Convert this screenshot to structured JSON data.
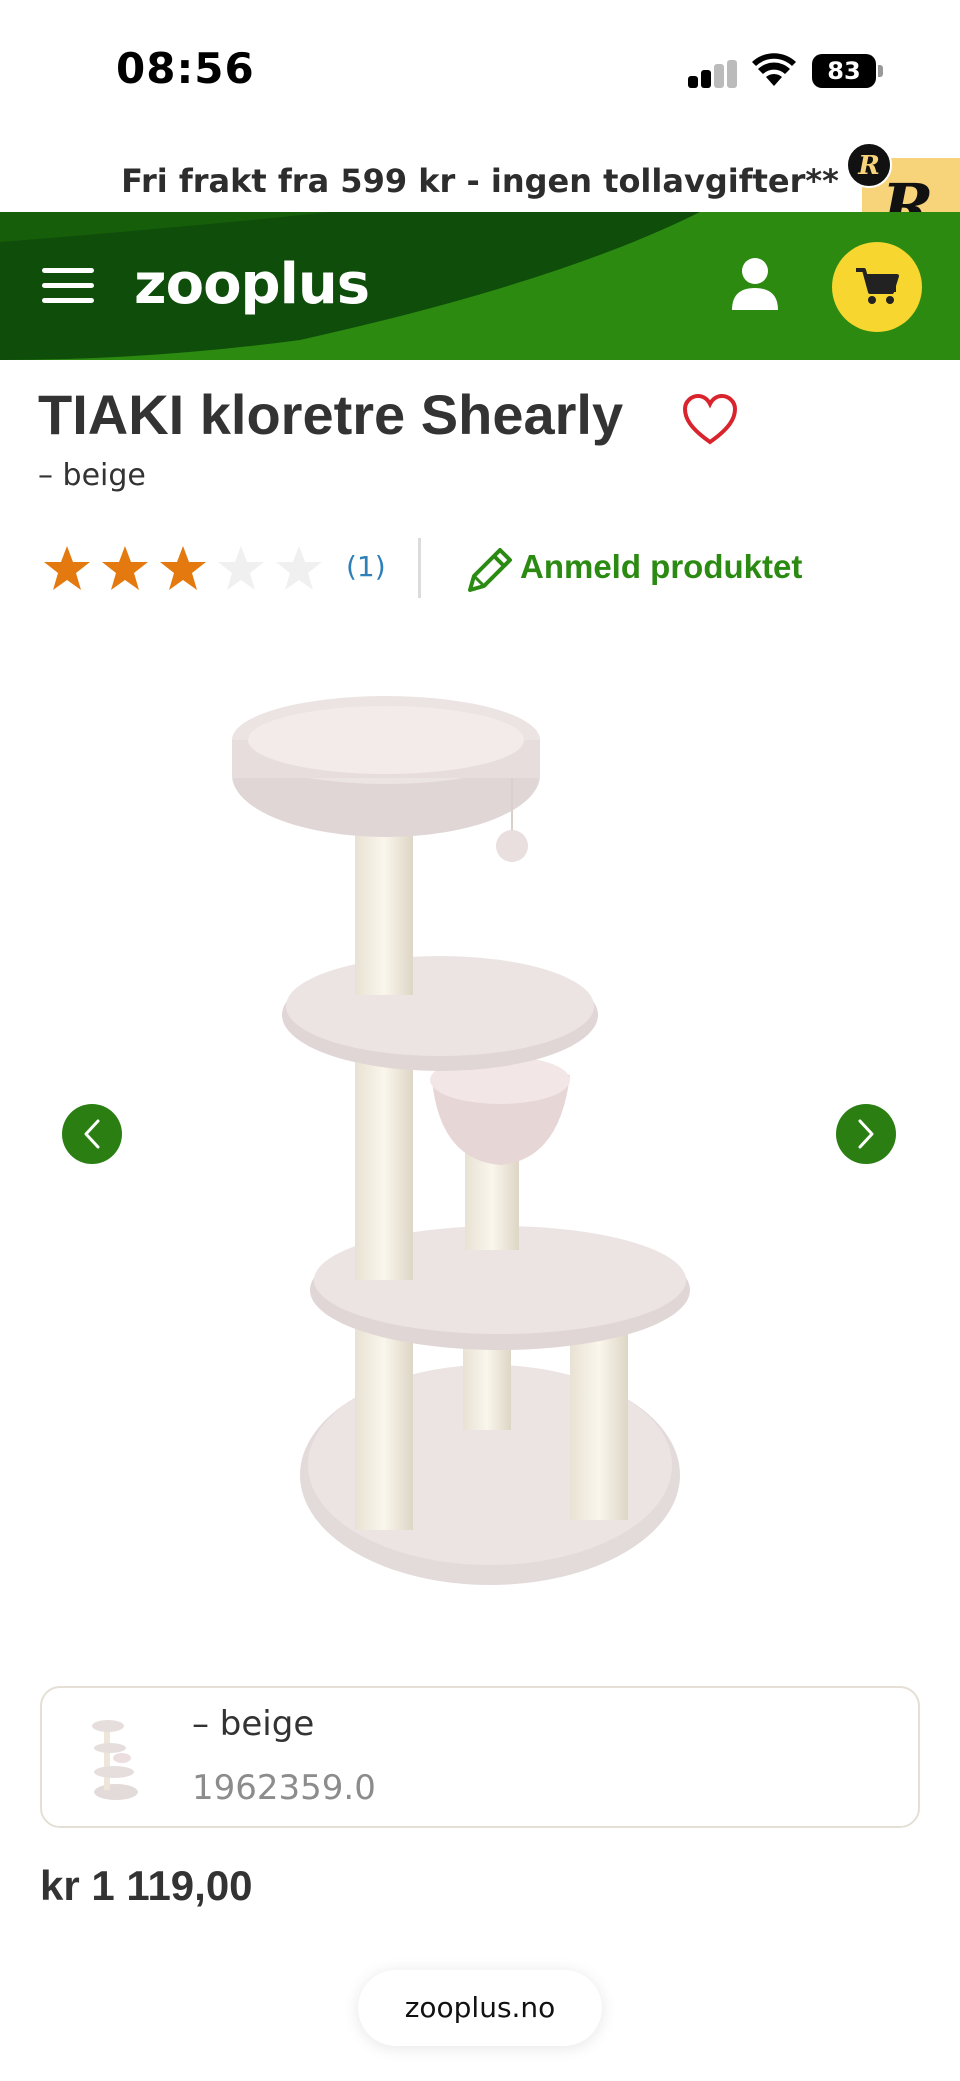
{
  "status_bar": {
    "time": "08:56",
    "battery_level": "83",
    "icons": [
      "cellular-signal-icon",
      "wifi-icon",
      "battery-icon"
    ]
  },
  "promo": {
    "text": "Fri frakt fra 599 kr - ingen tollavgifter**"
  },
  "extension_badge": {
    "letter": "R",
    "color": "#f7d37a"
  },
  "header": {
    "logo": "zooplus",
    "brand_green": "#2c8a10",
    "brand_dark_green": "#0e4d0a",
    "cart_color": "#f7d62f",
    "icons": [
      "menu-icon",
      "user-icon",
      "cart-icon"
    ]
  },
  "product": {
    "title": "TIAKI kloretre Shearly",
    "subtitle": "– beige",
    "rating": {
      "value": 3,
      "max": 5,
      "count_label": "(1)",
      "star_color": "#e3790f",
      "empty_star_color": "#f0f0f0"
    },
    "review_link": "Anmeld produktet",
    "image_alt_icon": "cat-tree-image",
    "carousel": {
      "prev_icon": "chevron-left-icon",
      "next_icon": "chevron-right-icon"
    },
    "variant": {
      "name": "– beige",
      "sku": "1962359.0"
    },
    "price": "kr 1 119,00"
  },
  "browser": {
    "url": "zooplus.no"
  }
}
